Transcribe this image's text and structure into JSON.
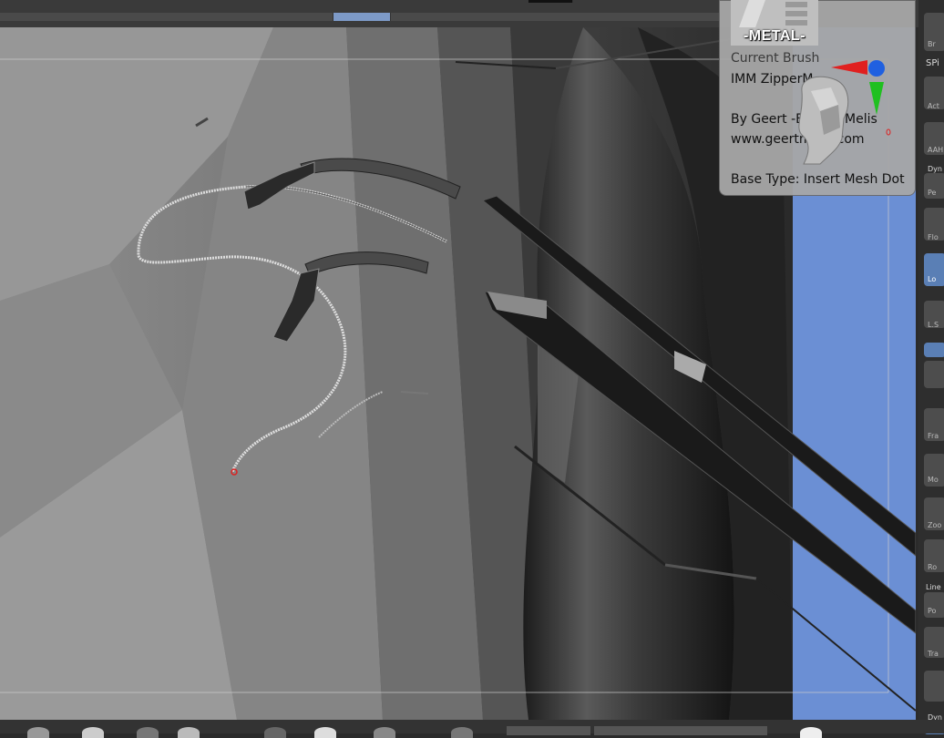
{
  "brush_popup": {
    "thumbnail_label": "-METAL-",
    "current_brush_label": "Current Brush",
    "brush_name": "IMM ZipperM",
    "author": "By Geert -Etcher- Melis",
    "website": "www.geertmelis.com",
    "base_type": "Base Type: Insert Mesh Dot"
  },
  "right_shelf": {
    "items": [
      {
        "label": "Br"
      },
      {
        "label": "SPi"
      },
      {
        "label": "Act"
      },
      {
        "label": "AAH"
      },
      {
        "label": "Dyn"
      },
      {
        "label": "Pe"
      },
      {
        "label": "Flo"
      },
      {
        "label": "Lo"
      },
      {
        "label": "L.S"
      },
      {
        "label": "Fra"
      },
      {
        "label": "Mo"
      },
      {
        "label": "Zoo"
      },
      {
        "label": "Ro"
      },
      {
        "label": "Line"
      },
      {
        "label": "Po"
      },
      {
        "label": "Tra"
      },
      {
        "label": "Dyn"
      }
    ]
  },
  "colors": {
    "accent": "#7d9ac8",
    "viewport_bg": "#6b8fd4",
    "selected_button": "#5a7fb5",
    "axis_x": "#e02020",
    "axis_y": "#20c020",
    "axis_z": "#2060e0"
  },
  "icons": {
    "gizmo": "axis-gizmo-icon",
    "head": "head-icon"
  }
}
